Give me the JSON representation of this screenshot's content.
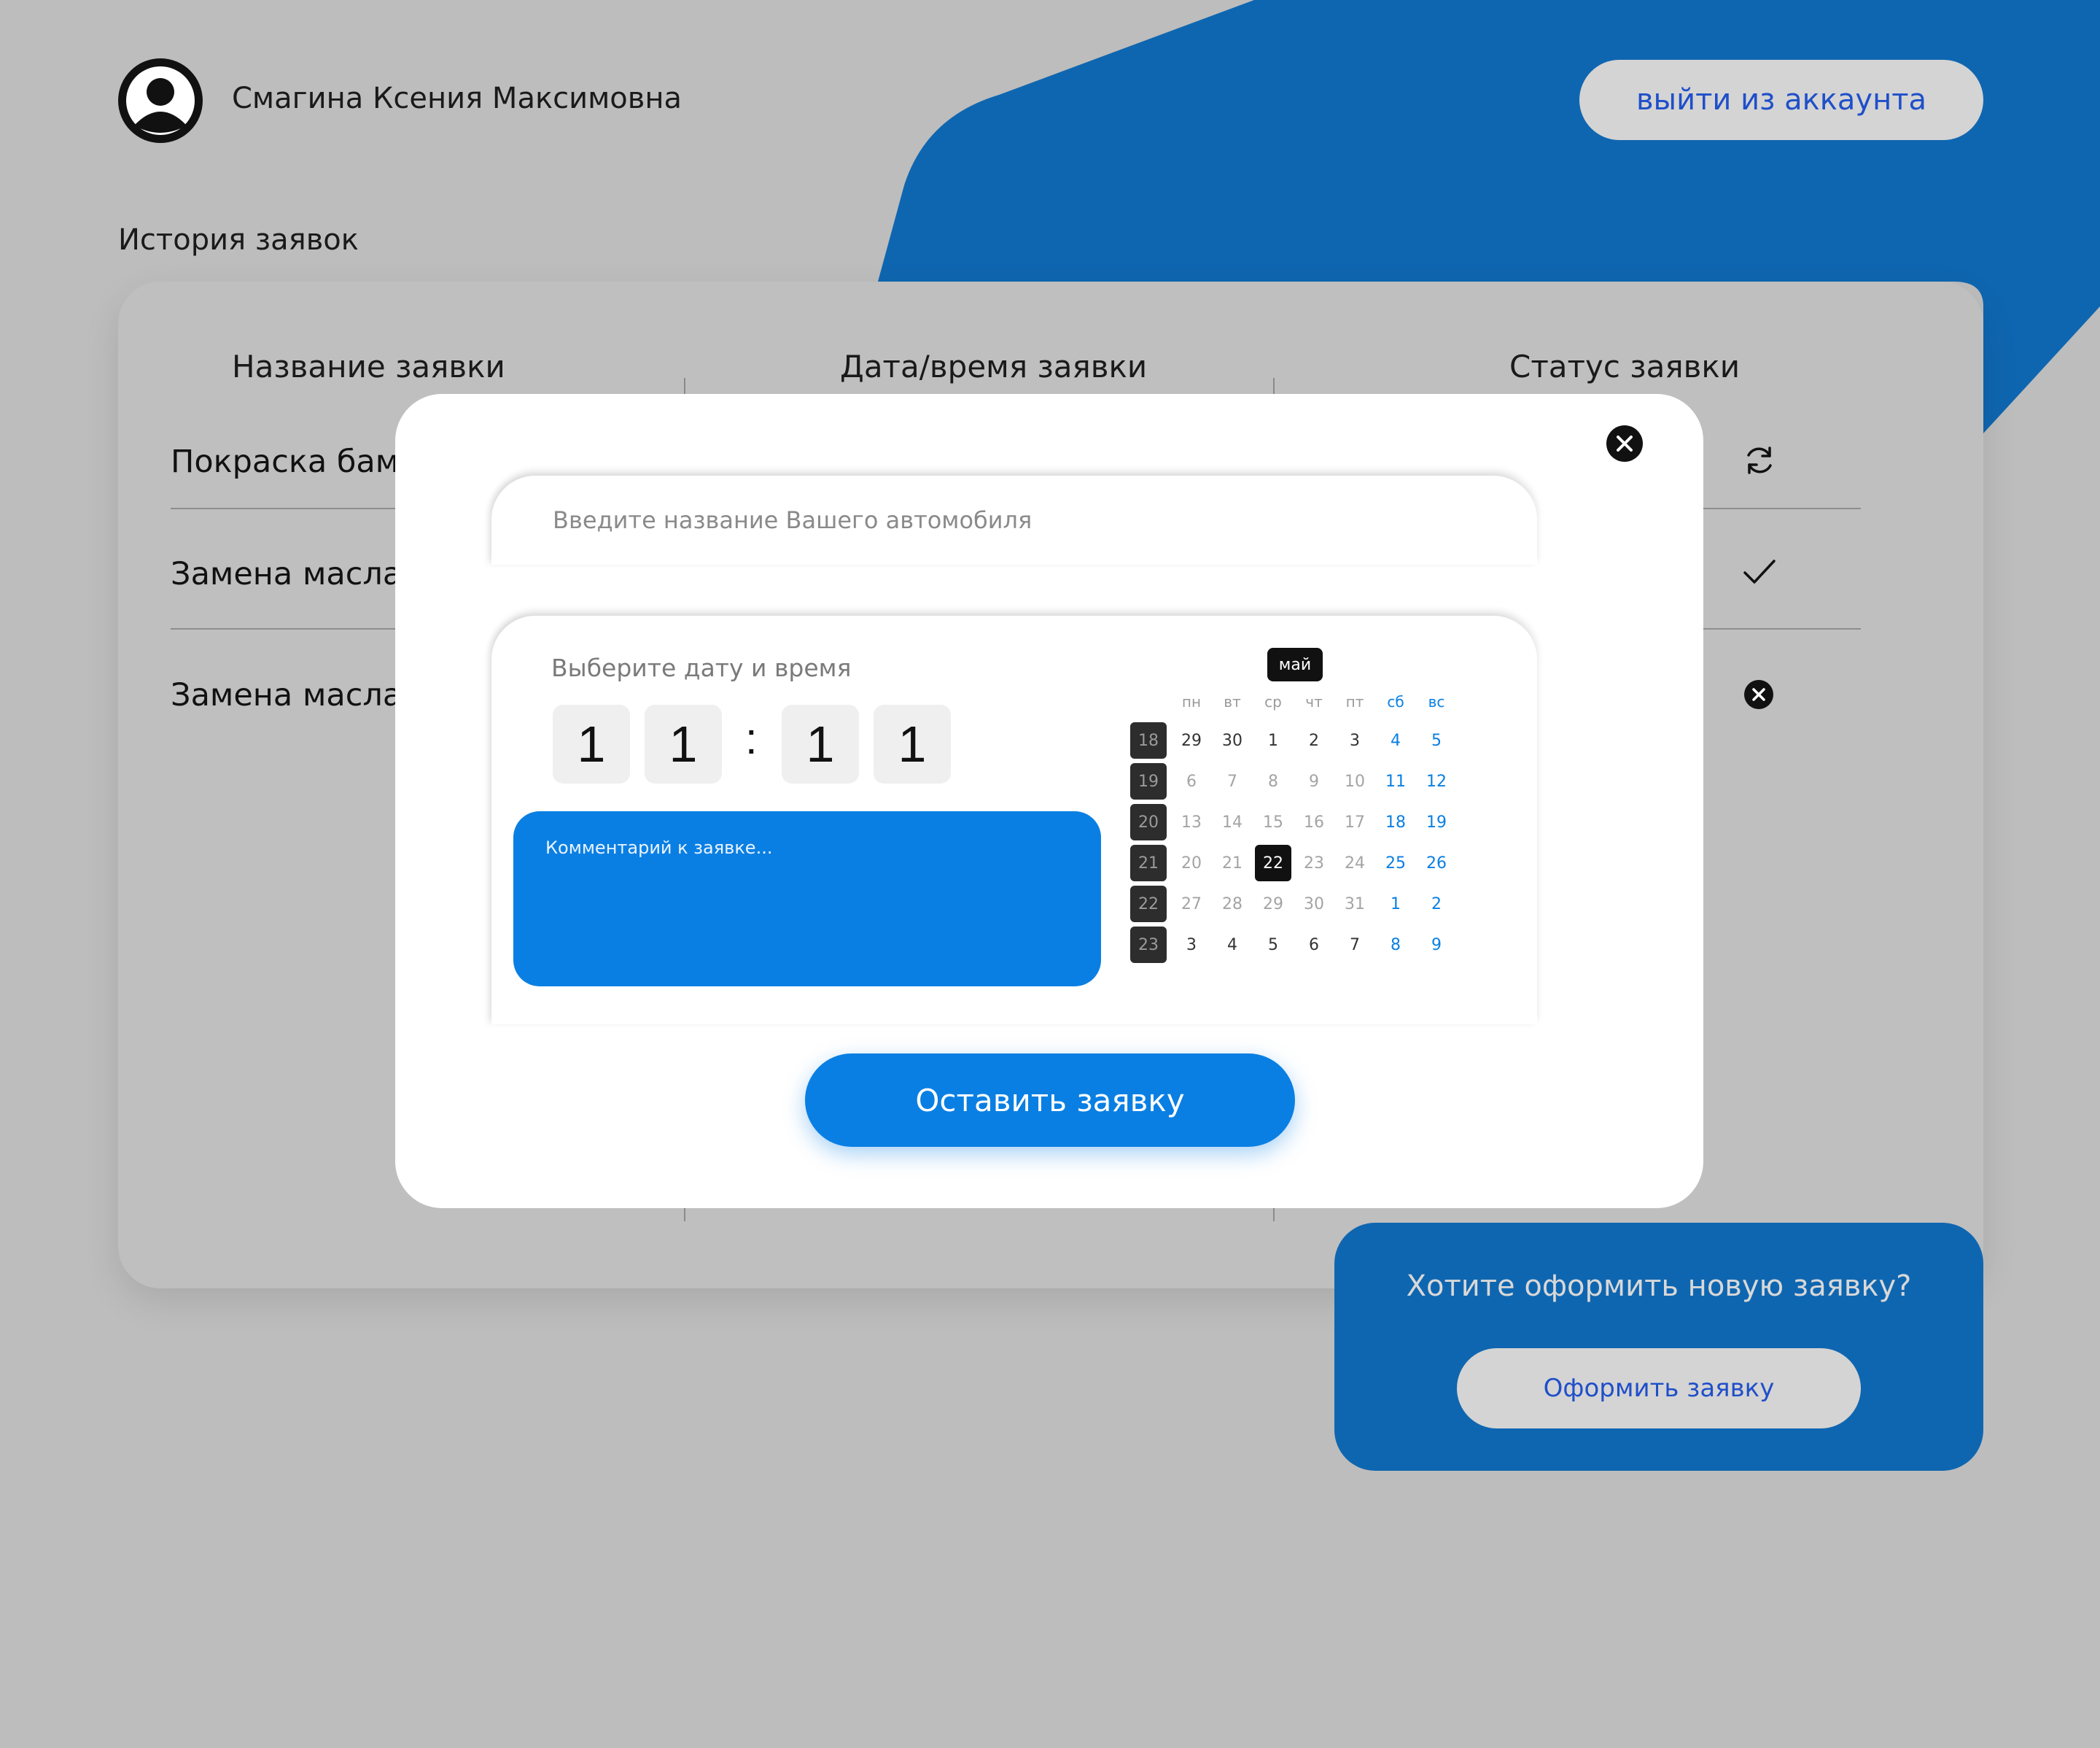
{
  "user": {
    "name": "Смагина Ксения Максимовна",
    "avatar_icon": "user-silhouette-icon",
    "logout_label": "выйти из аккаунта"
  },
  "history": {
    "title": "История заявок",
    "columns": [
      "Название заявки",
      "Дата/время заявки",
      "Статус заявки"
    ],
    "rows": [
      {
        "name": "Покраска бамп",
        "status": "refresh-icon"
      },
      {
        "name": "Замена масла",
        "status": "checkmark-icon"
      },
      {
        "name": "Замена масла",
        "status": "close-circle-icon"
      }
    ]
  },
  "modal": {
    "close_icon": "close-circle-icon",
    "car_placeholder": "Введите название Вашего автомобиля",
    "datetime_label": "Выберите дату и время",
    "time_digits": [
      "1",
      "1",
      "1",
      "1"
    ],
    "time_separator": ":",
    "comment_placeholder": "Комментарий к заявке...",
    "submit_label": "Оставить заявку"
  },
  "calendar": {
    "month": "май",
    "weekdays": [
      "пн",
      "вт",
      "ср",
      "чт",
      "пт",
      "сб",
      "вс"
    ],
    "weeks": [
      {
        "num": "18",
        "days": [
          "29",
          "30",
          "1",
          "2",
          "3",
          "4",
          "5"
        ]
      },
      {
        "num": "19",
        "days": [
          "6",
          "7",
          "8",
          "9",
          "10",
          "11",
          "12"
        ]
      },
      {
        "num": "20",
        "days": [
          "13",
          "14",
          "15",
          "16",
          "17",
          "18",
          "19"
        ]
      },
      {
        "num": "21",
        "days": [
          "20",
          "21",
          "22",
          "23",
          "24",
          "25",
          "26"
        ]
      },
      {
        "num": "22",
        "days": [
          "27",
          "28",
          "29",
          "30",
          "31",
          "1",
          "2"
        ]
      },
      {
        "num": "23",
        "days": [
          "3",
          "4",
          "5",
          "6",
          "7",
          "8",
          "9"
        ]
      }
    ],
    "selected_day": "22"
  },
  "new_request": {
    "title": "Хотите оформить новую заявку?",
    "button_label": "Оформить заявку"
  },
  "colors": {
    "accent": "#0a7fe3",
    "brand_blue": "#0f66b0",
    "background": "#bdbdbd"
  }
}
